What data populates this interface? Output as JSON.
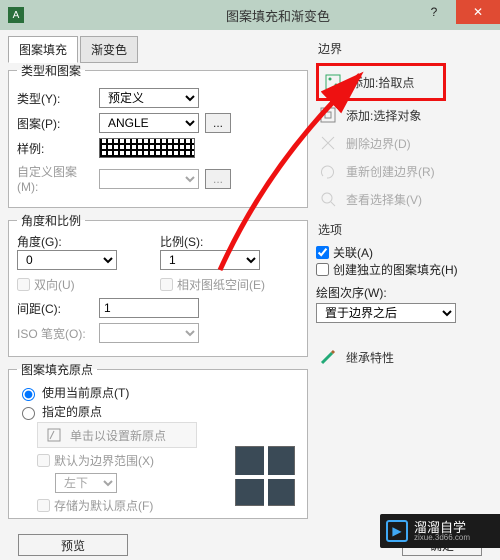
{
  "titlebar": {
    "title": "图案填充和渐变色",
    "close": "✕",
    "min": "—",
    "help": "?"
  },
  "tabs": {
    "t1": "图案填充",
    "t2": "渐变色"
  },
  "typepattern": {
    "legend": "类型和图案",
    "type_label": "类型(Y):",
    "type_value": "预定义",
    "pattern_label": "图案(P):",
    "pattern_value": "ANGLE",
    "more": "...",
    "sample_label": "样例:",
    "custom_label": "自定义图案(M):"
  },
  "angle": {
    "legend": "角度和比例",
    "ang_label": "角度(G):",
    "ang_value": "0",
    "scale_label": "比例(S):",
    "scale_value": "1",
    "bidi": "双向(U)",
    "paper": "相对图纸空间(E)",
    "gap_label": "间距(C):",
    "gap_value": "1",
    "iso_label": "ISO 笔宽(O):"
  },
  "origin": {
    "legend": "图案填充原点",
    "r1": "使用当前原点(T)",
    "r2": "指定的原点",
    "set": "单击以设置新原点",
    "def": "默认为边界范围(X)",
    "pos": "左下",
    "store": "存储为默认原点(F)"
  },
  "side": {
    "boundary_title": "边界",
    "b1": "添加:拾取点",
    "b2": "添加:选择对象",
    "b3": "删除边界(D)",
    "b4": "重新创建边界(R)",
    "b5": "查看选择集(V)",
    "options_title": "选项",
    "o1": "关联(A)",
    "o2": "创建独立的图案填充(H)",
    "draworder_label": "绘图次序(W):",
    "draworder_value": "置于边界之后",
    "inherit": "继承特性"
  },
  "footer": {
    "preview": "预览",
    "ok": "确定"
  },
  "brand": {
    "name": "溜溜自学",
    "site": "zixue.3d66.com"
  }
}
